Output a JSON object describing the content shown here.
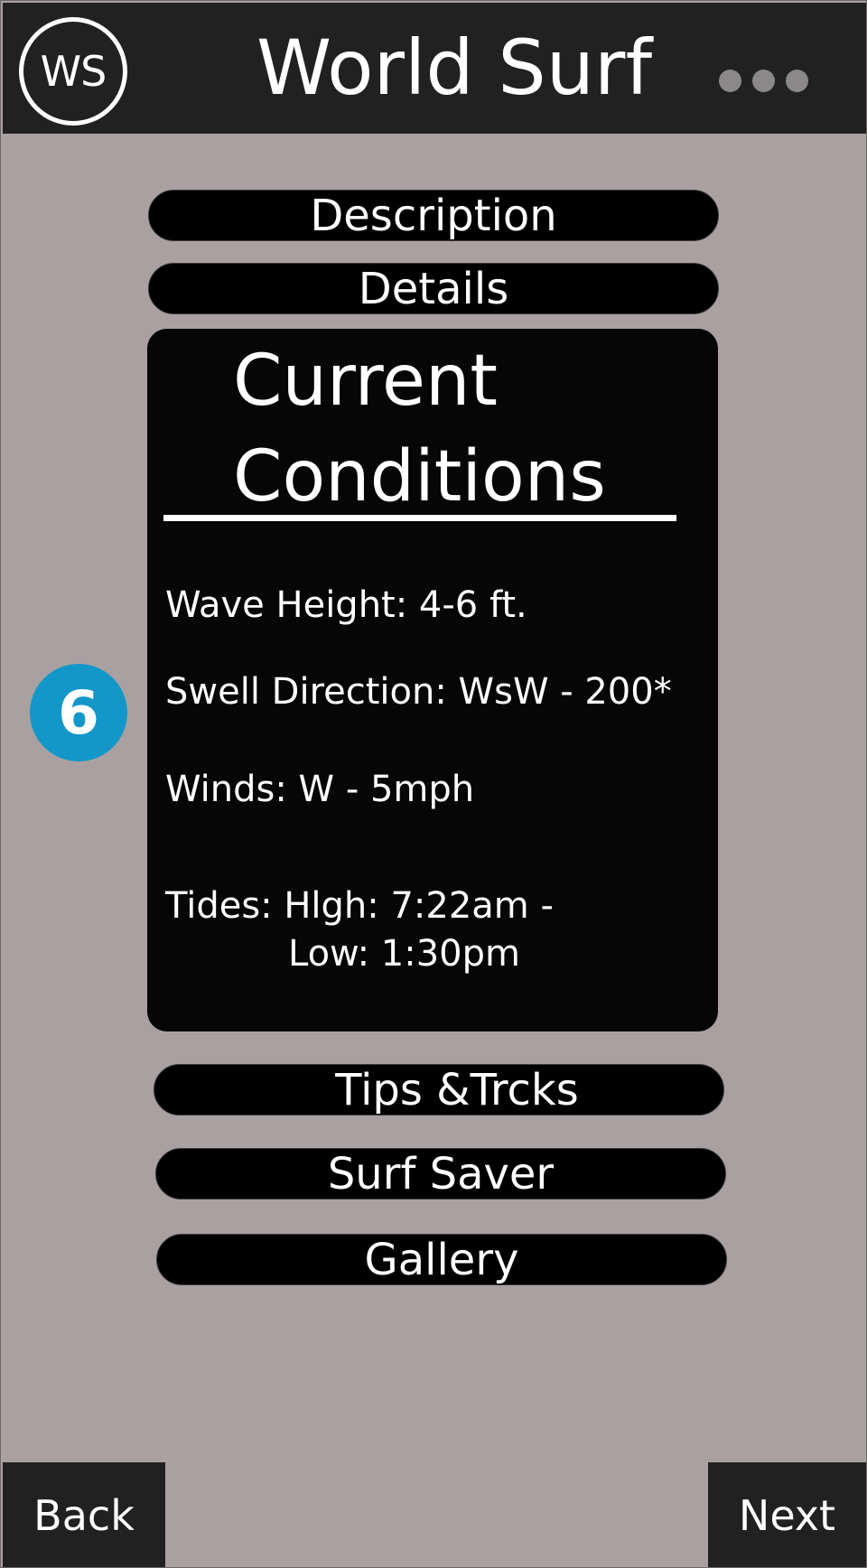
{
  "header": {
    "logo_text": "WS",
    "title": "World Surf",
    "menu_icon": "more-dots-icon"
  },
  "sections": {
    "description": "Description",
    "details": "Details",
    "tips": "Tips &Trcks",
    "surf_saver": "Surf Saver",
    "gallery": "Gallery"
  },
  "conditions": {
    "title": "Current\nConditions",
    "wave_height": "Wave Height:  4-6 ft.",
    "swell_direction": "Swell Direction: WsW - 200*",
    "winds": "Winds: W - 5mph",
    "tides_line1": "Tides: Hlgh: 7:22am  -",
    "tides_line2": "Low: 1:30pm"
  },
  "step_badge": "6",
  "footer": {
    "back": "Back",
    "next": "Next"
  },
  "colors": {
    "background": "#a9a1a1",
    "header": "#222121",
    "panel": "#060606",
    "badge": "#1397c8"
  }
}
